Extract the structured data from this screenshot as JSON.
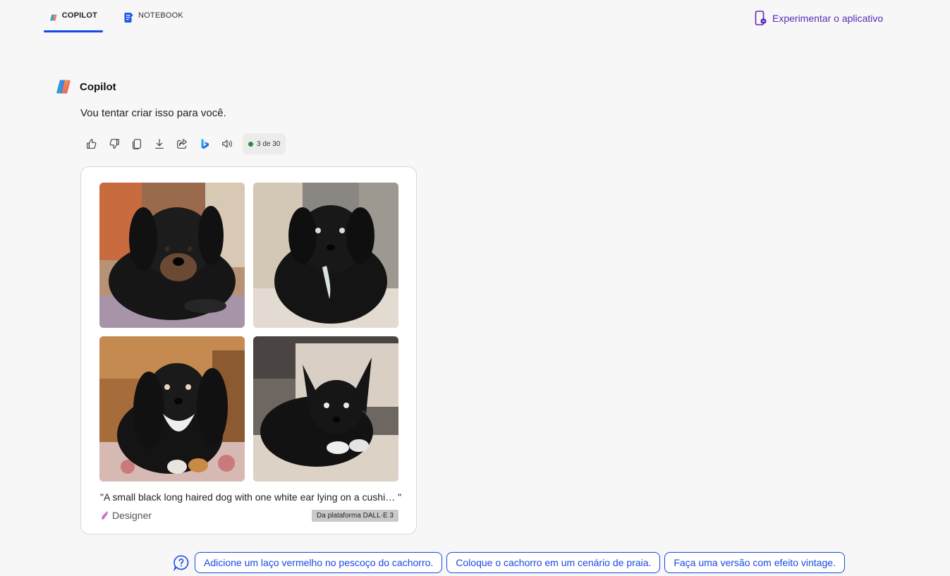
{
  "tabs": [
    {
      "label": "COPILOT",
      "icon": "copilot-logo-icon",
      "active": true
    },
    {
      "label": "NOTEBOOK",
      "icon": "notebook-icon",
      "active": false
    }
  ],
  "header": {
    "try_app_label": "Experimentar o aplicativo"
  },
  "message": {
    "author": "Copilot",
    "text": "Vou tentar criar isso para você.",
    "counter": "3 de 30",
    "counter_color": "#2b8a3e"
  },
  "actions": [
    "like-icon",
    "dislike-icon",
    "copy-icon",
    "download-icon",
    "share-icon",
    "bing-icon",
    "read-aloud-icon"
  ],
  "card": {
    "caption": "\"A small black long haired dog with one white ear lying on a cushi… \"",
    "designer_label": "Designer",
    "badge": "Da plataforma DALL·E 3"
  },
  "suggestions": [
    "Adicione um laço vermelho no pescoço do cachorro.",
    "Coloque o cachorro em um cenário de praia.",
    "Faça uma versão com efeito vintage."
  ],
  "colors": {
    "accent": "#174ae4",
    "try_app": "#5b2bb8",
    "background": "#f7f7f7"
  }
}
